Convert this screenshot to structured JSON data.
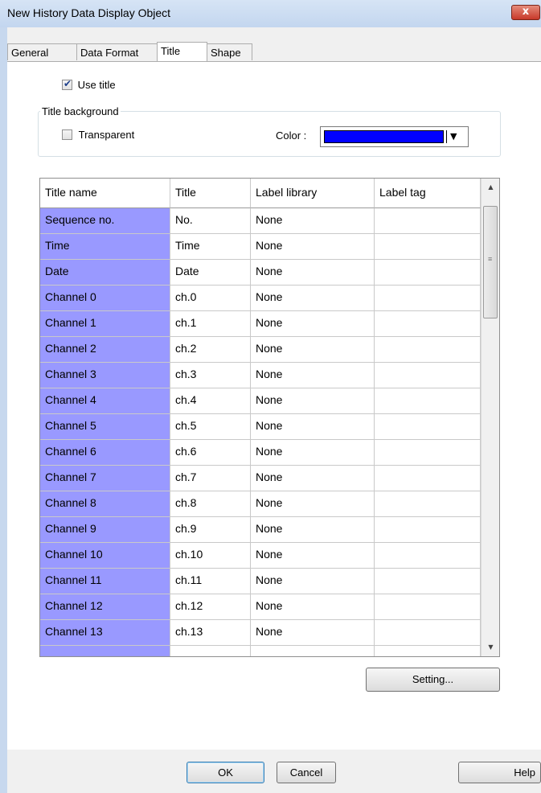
{
  "window": {
    "title": "New  History Data Display Object",
    "close": "x"
  },
  "tabs": [
    {
      "label": "General"
    },
    {
      "label": "Data Format"
    },
    {
      "label": "Title"
    },
    {
      "label": "Shape"
    }
  ],
  "use_title": {
    "label": "Use title",
    "checked": true
  },
  "title_background": {
    "group_label": "Title background",
    "transparent_label": "Transparent",
    "transparent_checked": false,
    "color_label": "Color :",
    "color_value": "#0000ff"
  },
  "table": {
    "headers": [
      "Title name",
      "Title",
      "Label library",
      "Label tag"
    ],
    "rows": [
      [
        "Sequence no.",
        "No.",
        "None",
        ""
      ],
      [
        "Time",
        "Time",
        "None",
        ""
      ],
      [
        "Date",
        "Date",
        "None",
        ""
      ],
      [
        "Channel 0",
        "ch.0",
        "None",
        ""
      ],
      [
        "Channel 1",
        "ch.1",
        "None",
        ""
      ],
      [
        "Channel 2",
        "ch.2",
        "None",
        ""
      ],
      [
        "Channel 3",
        "ch.3",
        "None",
        ""
      ],
      [
        "Channel 4",
        "ch.4",
        "None",
        ""
      ],
      [
        "Channel 5",
        "ch.5",
        "None",
        ""
      ],
      [
        "Channel 6",
        "ch.6",
        "None",
        ""
      ],
      [
        "Channel 7",
        "ch.7",
        "None",
        ""
      ],
      [
        "Channel 8",
        "ch.8",
        "None",
        ""
      ],
      [
        "Channel 9",
        "ch.9",
        "None",
        ""
      ],
      [
        "Channel 10",
        "ch.10",
        "None",
        ""
      ],
      [
        "Channel 11",
        "ch.11",
        "None",
        ""
      ],
      [
        "Channel 12",
        "ch.12",
        "None",
        ""
      ],
      [
        "Channel 13",
        "ch.13",
        "None",
        ""
      ],
      [
        "",
        "",
        "",
        ""
      ]
    ],
    "name_column_color": "#9999ff"
  },
  "buttons": {
    "setting": "Setting...",
    "ok": "OK",
    "cancel": "Cancel",
    "help": "Help"
  },
  "icons": {
    "checkmark": "✔",
    "dropdown": "▼",
    "scroll_up": "▲",
    "scroll_down": "▼",
    "grip": "≡"
  }
}
